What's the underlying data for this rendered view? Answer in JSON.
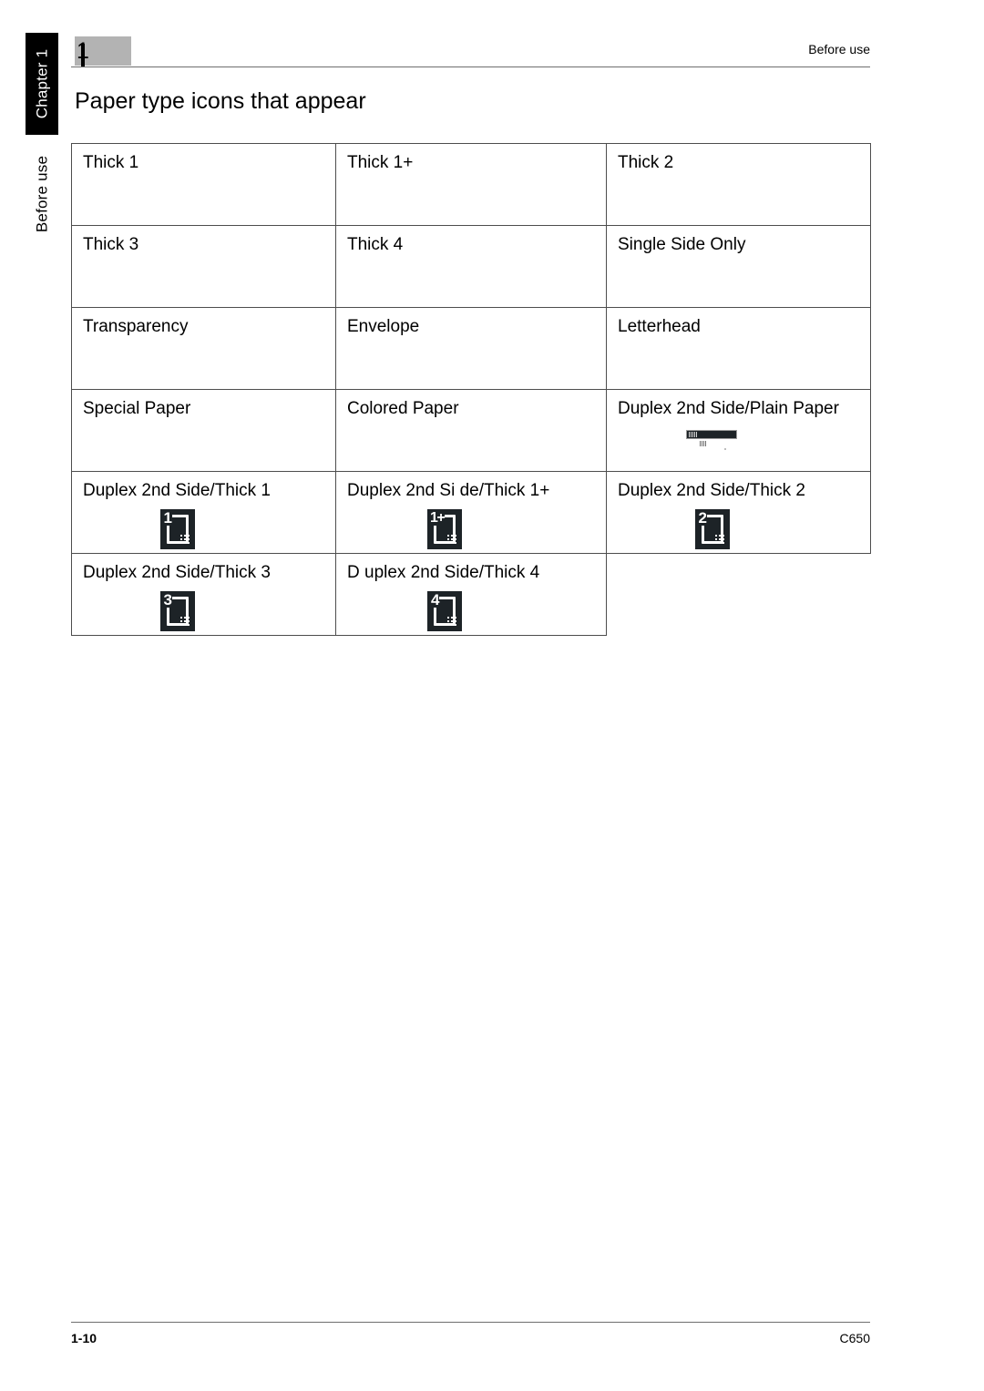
{
  "sidebar": {
    "chapter_tab_label": "Chapter 1",
    "section_tab_label": "Before use"
  },
  "header": {
    "chapter_number": "1",
    "running_head": "Before use"
  },
  "title": "Paper type icons that appear",
  "table": {
    "rows": [
      {
        "cells": [
          {
            "label": "Thick 1",
            "icon": "none"
          },
          {
            "label": "Thick 1+",
            "icon": "none"
          },
          {
            "label": "Thick 2",
            "icon": "none"
          }
        ]
      },
      {
        "cells": [
          {
            "label": "Thick 3",
            "icon": "none"
          },
          {
            "label": "Thick 4",
            "icon": "none"
          },
          {
            "label": "Single Side Only",
            "icon": "none"
          }
        ]
      },
      {
        "cells": [
          {
            "label": "Transparency",
            "icon": "none"
          },
          {
            "label": "Envelope",
            "icon": "none"
          },
          {
            "label": "Letterhead",
            "icon": "none"
          }
        ]
      },
      {
        "cells": [
          {
            "label": "Special Paper",
            "icon": "none"
          },
          {
            "label": "Colored Paper",
            "icon": "none"
          },
          {
            "label": "Duplex 2nd Side/Plain Paper",
            "icon": "artifact"
          }
        ]
      },
      {
        "cells": [
          {
            "label": "Duplex 2nd Side/Thick 1",
            "icon": "duplex",
            "icon_numeral": "1"
          },
          {
            "label": "Duplex 2nd Si de/Thick 1+",
            "icon": "duplex",
            "icon_numeral": "1+"
          },
          {
            "label": "Duplex 2nd Side/Thick 2",
            "icon": "duplex",
            "icon_numeral": "2"
          }
        ]
      },
      {
        "cells": [
          {
            "label": "Duplex 2nd Side/Thick 3",
            "icon": "duplex",
            "icon_numeral": "3"
          },
          {
            "label": "D uplex 2nd Side/Thick 4",
            "icon": "duplex",
            "icon_numeral": "4"
          },
          {
            "label": "",
            "icon": "none",
            "blank": true
          }
        ]
      }
    ]
  },
  "footer": {
    "page_number": "1-10",
    "model": "C650"
  },
  "colors": {
    "chapter_tab_background": "#000000",
    "chapter_chip_background": "#b3b3b3",
    "rule": "#6e6e6e",
    "table_border": "#4d4d4d",
    "icon_tile": "#1d2327",
    "text": "#000000"
  }
}
